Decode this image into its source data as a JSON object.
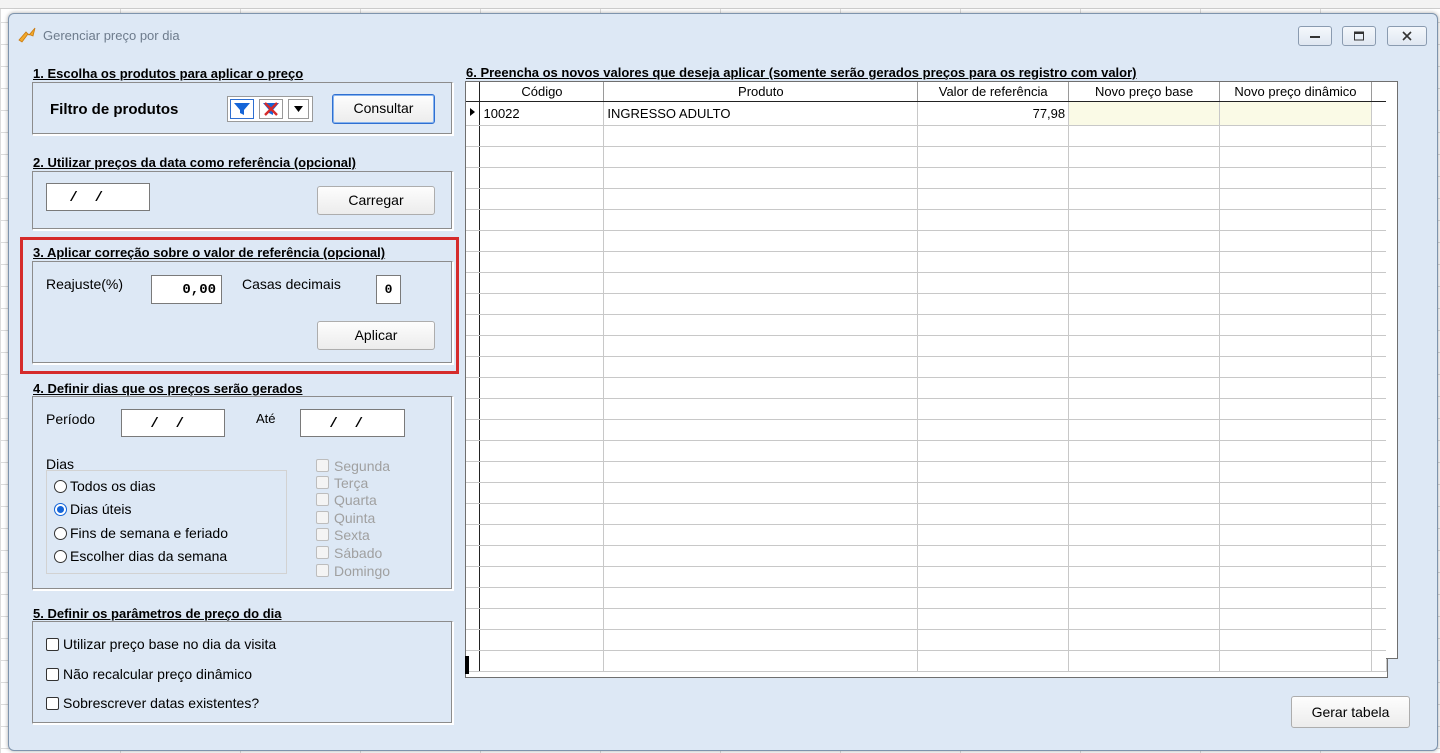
{
  "window": {
    "title": "Gerenciar preço por dia"
  },
  "section1": {
    "title": "1. Escolha os produtos para aplicar o preço",
    "filter_label": "Filtro de produtos",
    "consult_label": "Consultar"
  },
  "section2": {
    "title": "2. Utilizar preços da data como referência (opcional)",
    "date_value": " /  /",
    "load_label": "Carregar"
  },
  "section3": {
    "title": "3. Aplicar correção sobre o valor de referência (opcional)",
    "adjust_label": "Reajuste(%)",
    "adjust_value": "0,00",
    "decimals_label": "Casas decimais",
    "decimals_value": "0",
    "apply_label": "Aplicar"
  },
  "section4": {
    "title": "4. Definir dias que os preços serão gerados",
    "period_label": "Período",
    "period_from": " /  /",
    "until_label": "Até",
    "period_to": " /  /",
    "days_label": "Dias",
    "day_modes": [
      {
        "label": "Todos os dias",
        "selected": false
      },
      {
        "label": "Dias úteis",
        "selected": true
      },
      {
        "label": "Fins de semana e feriado",
        "selected": false
      },
      {
        "label": "Escolher dias da semana",
        "selected": false
      }
    ],
    "weekdays": [
      "Segunda",
      "Terça",
      "Quarta",
      "Quinta",
      "Sexta",
      "Sábado",
      "Domingo"
    ]
  },
  "section5": {
    "title": "5. Definir os parâmetros de preço do dia",
    "options": [
      {
        "label": "Utilizar preço base no dia da visita",
        "checked": false
      },
      {
        "label": "Não recalcular preço dinâmico",
        "checked": false
      },
      {
        "label": "Sobrescrever datas existentes?",
        "checked": false
      }
    ]
  },
  "section6": {
    "title": "6. Preencha os novos valores que deseja aplicar (somente serão gerados preços para os registro com valor)",
    "columns": [
      "Código",
      "Produto",
      "Valor de referência",
      "Novo preço base",
      "Novo preço dinâmico"
    ],
    "rows": [
      {
        "codigo": "10022",
        "produto": "INGRESSO ADULTO",
        "valor_referencia": "77,98",
        "novo_preco_base": "",
        "novo_preco_dinamico": ""
      }
    ]
  },
  "footer": {
    "generate_label": "Gerar tabela"
  },
  "colors": {
    "highlight": "#d52b2b",
    "accent": "#1565d8"
  }
}
